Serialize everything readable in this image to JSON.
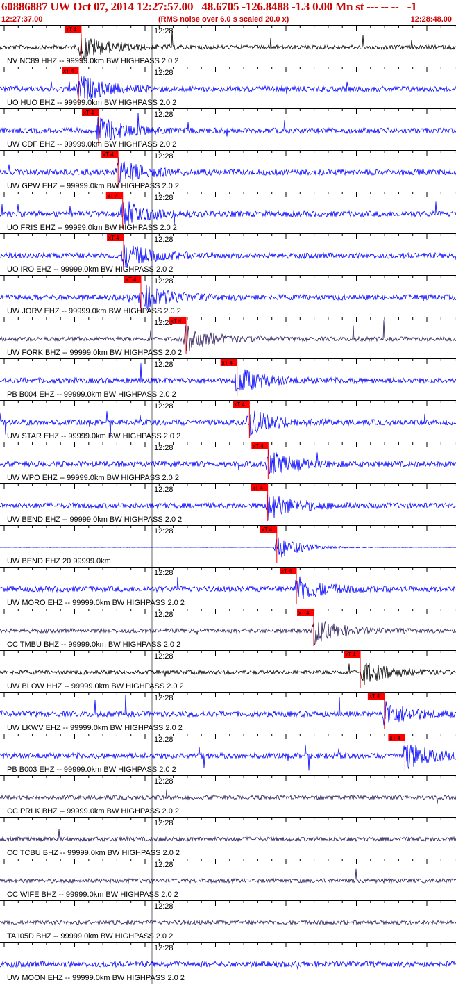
{
  "header": {
    "title": "60886887 UW Oct 07, 2014 12:27:57.00   48.6705 -126.8488 -1.3 0.00 Mn st --- -- --   -1",
    "start_time": "12:27:37.00",
    "rms_note": "(RMS noise over 6.0 s scaled 20.0 x)",
    "end_time": "12:28:48.00"
  },
  "tick_label": "12:28",
  "pick_label": "xT 4",
  "colors": {
    "header": "#cc0000",
    "grid": "#000000",
    "pick": "#ff0000"
  },
  "traces": [
    {
      "label": "NV NC89 HHZ -- 99999.0km BW  HIGHPASS  2.0  2",
      "color": "#000000",
      "pick": 0.178
    },
    {
      "label": "UO HUO EHZ -- 99999.0km BW  HIGHPASS  2.0  2",
      "color": "#0000ff",
      "pick": 0.172
    },
    {
      "label": "UW CDF EHZ -- 99999.0km BW  HIGHPASS  2.0  2",
      "color": "#0000ff",
      "pick": 0.216
    },
    {
      "label": "UW GPW EHZ -- 99999.0km BW  HIGHPASS  2.0  2",
      "color": "#0000ff",
      "pick": 0.259
    },
    {
      "label": "UO FRIS EHZ -- 99999.0km BW  HIGHPASS  2.0  2",
      "color": "#0000ff",
      "pick": 0.269
    },
    {
      "label": "UO IRO EHZ -- 99999.0km BW  HIGHPASS  2.0  2",
      "color": "#0000ff",
      "pick": 0.271
    },
    {
      "label": "UW JORV EHZ -- 99999.0km BW  HIGHPASS  2.0  2",
      "color": "#0000ff",
      "pick": 0.309
    },
    {
      "label": "UW FORK BHZ -- 99999.0km BW  HIGHPASS  2.0  2",
      "color": "#2a1a5a",
      "pick": 0.408
    },
    {
      "label": "PB B004 EHZ -- 99999.0km BW  HIGHPASS  2.0  2",
      "color": "#0000ff",
      "pick": 0.52
    },
    {
      "label": "UW STAR EHZ -- 99999.0km BW  HIGHPASS  2.0  2",
      "color": "#0000ff",
      "pick": 0.547
    },
    {
      "label": "UW WPO EHZ -- 99999.0km BW  HIGHPASS  2.0  2",
      "color": "#0000ff",
      "pick": 0.588
    },
    {
      "label": "UW BEND EHZ -- 99999.0km BW  HIGHPASS  2.0  2",
      "color": "#0000ff",
      "pick": 0.587
    },
    {
      "label": "UW BEND EHZ 20 99999.0km",
      "color": "#0000ff",
      "pick": 0.607
    },
    {
      "label": "UW MORO EHZ -- 99999.0km BW  HIGHPASS  2.0  2",
      "color": "#0000ff",
      "pick": 0.65
    },
    {
      "label": "CC TMBU BHZ -- 99999.0km BW  HIGHPASS  2.0  2",
      "color": "#2a1a5a",
      "pick": 0.688
    },
    {
      "label": "UW BLOW HHZ -- 99999.0km BW  HIGHPASS  2.0  2",
      "color": "#000000",
      "pick": 0.79
    },
    {
      "label": "UW LKWV EHZ -- 99999.0km BW  HIGHPASS  2.0  2",
      "color": "#0000ff",
      "pick": 0.843
    },
    {
      "label": "PB B003 EHZ -- 99999.0km BW  HIGHPASS  2.0  2",
      "color": "#0000ff",
      "pick": 0.888
    },
    {
      "label": "CC PRLK BHZ -- 99999.0km BW  HIGHPASS  2.0  2",
      "color": "#2a1a5a",
      "pick": null
    },
    {
      "label": "CC TCBU BHZ -- 99999.0km BW  HIGHPASS  2.0  2",
      "color": "#2a1a5a",
      "pick": null
    },
    {
      "label": "CC WIFE BHZ -- 99999.0km BW  HIGHPASS  2.0  2",
      "color": "#2a1a5a",
      "pick": null
    },
    {
      "label": "TA I05D BHZ -- 99999.0km BW  HIGHPASS  2.0  2",
      "color": "#2a1a5a",
      "pick": null
    },
    {
      "label": "UW MOON EHZ -- 99999.0km BW  HIGHPASS  2.0  2",
      "color": "#0000ff",
      "pick": null
    }
  ]
}
